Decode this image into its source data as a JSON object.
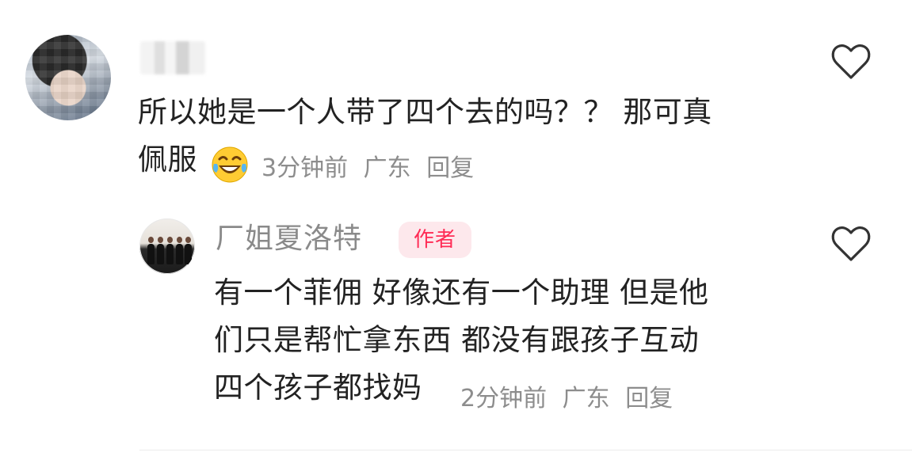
{
  "comments": [
    {
      "text": "所以她是一个人带了四个去的吗？？ 那可真\n佩服",
      "emoji": "laughing-tears-emoji",
      "time": "3分钟前",
      "location": "广东",
      "reply_label": "回复",
      "like_icon": "heart-outline-icon"
    }
  ],
  "reply": {
    "username": "厂姐夏洛特",
    "badge": "作者",
    "text": "有一个菲佣 好像还有一个助理 但是他\n们只是帮忙拿东西 都没有跟孩子互动\n四个孩子都找妈",
    "time": "2分钟前",
    "location": "广东",
    "reply_label": "回复",
    "like_icon": "heart-outline-icon"
  },
  "colors": {
    "text": "#222222",
    "meta": "#8d8d8d",
    "badge_bg": "#fde8ec",
    "badge_text": "#ff2b55",
    "icon": "#333333"
  }
}
